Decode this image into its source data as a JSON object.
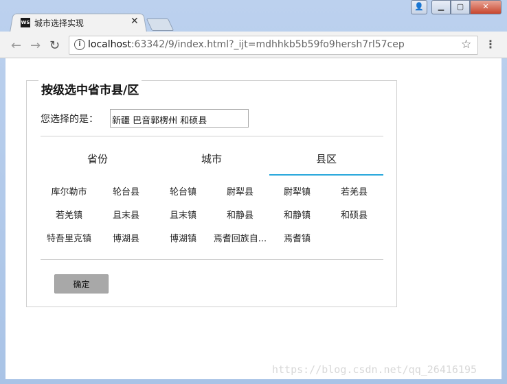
{
  "browser": {
    "tab_title": "城市选择实现",
    "favicon_text": "WS",
    "url_host": "localhost",
    "url_rest": ":63342/9/index.html?_ijt=mdhhkb5b59fo9hersh7rl57cep"
  },
  "form": {
    "legend": "按级选中省市县/区",
    "selected_label": "您选择的是：",
    "selected_value": "新疆 巴音郭楞州 和硕县",
    "tabs": [
      "省份",
      "城市",
      "县区"
    ],
    "active_tab": "县区",
    "items": [
      "库尔勒市",
      "轮台县",
      "轮台镇",
      "尉犁县",
      "尉犁镇",
      "若羌县",
      "若羌镇",
      "且末县",
      "且末镇",
      "和静县",
      "和静镇",
      "和硕县",
      "特吾里克镇",
      "博湖县",
      "博湖镇",
      "焉耆回族自...",
      "焉耆镇"
    ],
    "confirm_label": "确定"
  },
  "watermark": "https://blog.csdn.net/qq_26416195",
  "colors": {
    "active_tab_underline": "#2aa8dc",
    "confirm_bg": "#a8a8a8"
  }
}
